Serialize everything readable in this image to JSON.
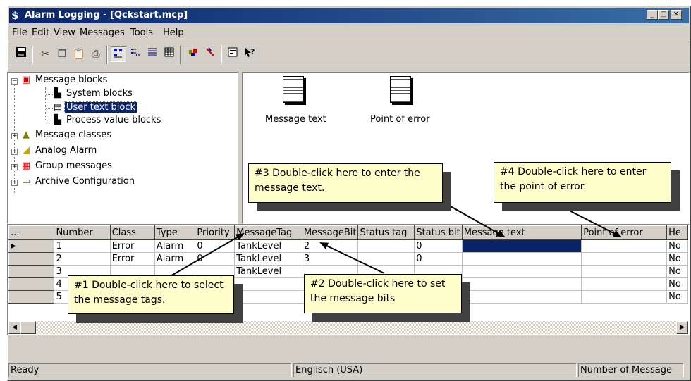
{
  "window": {
    "title": "Alarm Logging - [Qckstart.mcp]",
    "app_icon": "wincc-icon",
    "caption_buttons": [
      "_",
      "□",
      "✕"
    ]
  },
  "menu": [
    "File",
    "Edit",
    "View",
    "Messages",
    "Tools",
    "Help"
  ],
  "toolbar": {
    "buttons": [
      "save-icon",
      "cut-icon",
      "copy-icon",
      "paste-icon",
      "print-icon",
      "small-icons-view-icon",
      "list-view-icon",
      "details-view-icon",
      "grid-view-icon",
      "wizard-icon",
      "delete-icon",
      "properties-icon",
      "help-icon"
    ]
  },
  "tree": {
    "root": "Message blocks",
    "children": [
      "System blocks",
      "User text block",
      "Process value blocks"
    ],
    "selected": "User text block",
    "siblings": [
      "Message classes",
      "Analog Alarm",
      "Group messages",
      "Archive Configuration"
    ]
  },
  "blocks_pane": {
    "items": [
      "Message text",
      "Point of error"
    ]
  },
  "grid": {
    "corner": "...",
    "columns": [
      "Number",
      "Class",
      "Type",
      "Priority",
      "MessageTag",
      "MessageBit",
      "Status tag",
      "Status bit",
      "Message text",
      "Point of error",
      "He"
    ],
    "rows": [
      [
        "1",
        "Error",
        "Alarm",
        "0",
        "TankLevel",
        "2",
        "",
        "0",
        "",
        "",
        "No"
      ],
      [
        "2",
        "Error",
        "Alarm",
        "0",
        "TankLevel",
        "3",
        "",
        "0",
        "",
        "",
        "No"
      ],
      [
        "3",
        "",
        "",
        "",
        "TankLevel",
        "",
        "",
        "",
        "",
        "",
        "No"
      ],
      [
        "4",
        "",
        "",
        "",
        "",
        "",
        "",
        "",
        "",
        "",
        "No"
      ],
      [
        "5",
        "",
        "",
        "",
        "",
        "",
        "",
        "",
        "",
        "",
        "No"
      ]
    ],
    "current_row_marker": "▶"
  },
  "callouts": {
    "c1": "#1 Double-click here to select the message tags.",
    "c2": "#2 Double-click here to set the message bits",
    "c3": "#3 Double-click here to enter the message text.",
    "c4": "#4 Double-click here to enter the point of error."
  },
  "status": {
    "left": "Ready",
    "middle": "Englisch (USA)",
    "right": "Number of Message"
  }
}
